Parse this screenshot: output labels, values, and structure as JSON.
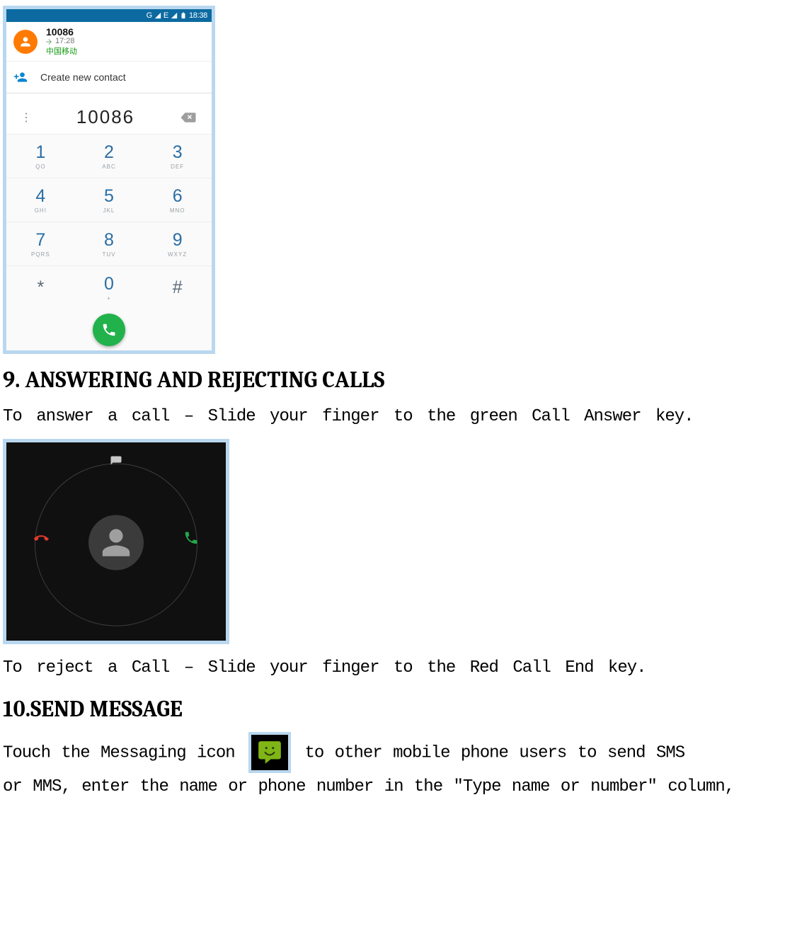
{
  "dialer": {
    "statusbar": {
      "wifi": "wifi-indicator",
      "net": "G",
      "sig1": "signal-triangle",
      "e": "E",
      "sig2": "signal-triangle",
      "batt": "battery-indicator",
      "time": "18:38"
    },
    "recent": {
      "number": "10086",
      "time": "17:28",
      "carrier": "中国移动"
    },
    "create_contact_label": "Create new contact",
    "entry_number": "10086",
    "keys": [
      {
        "d": "1",
        "l": "QO"
      },
      {
        "d": "2",
        "l": "ABC"
      },
      {
        "d": "3",
        "l": "DEF"
      },
      {
        "d": "4",
        "l": "GHI"
      },
      {
        "d": "5",
        "l": "JKL"
      },
      {
        "d": "6",
        "l": "MNO"
      },
      {
        "d": "7",
        "l": "PQRS"
      },
      {
        "d": "8",
        "l": "TUV"
      },
      {
        "d": "9",
        "l": "WXYZ"
      },
      {
        "d": "*",
        "l": ""
      },
      {
        "d": "0",
        "l": "+"
      },
      {
        "d": "#",
        "l": ""
      }
    ]
  },
  "sections": {
    "head9": "9. ANSWERING AND REJECTING CALLS",
    "p9a": "To answer a call – Slide your finger to the green Call Answer key.",
    "p9b": "To reject a Call – Slide your finger to the Red Call End key.",
    "head10": "10.SEND MESSAGE",
    "p10_pre": "Touch the Messaging icon ",
    "p10_post": " to other mobile phone users to send SMS",
    "p10_b": "or MMS, enter the name or phone number in the \"Type name or number\" column,"
  }
}
